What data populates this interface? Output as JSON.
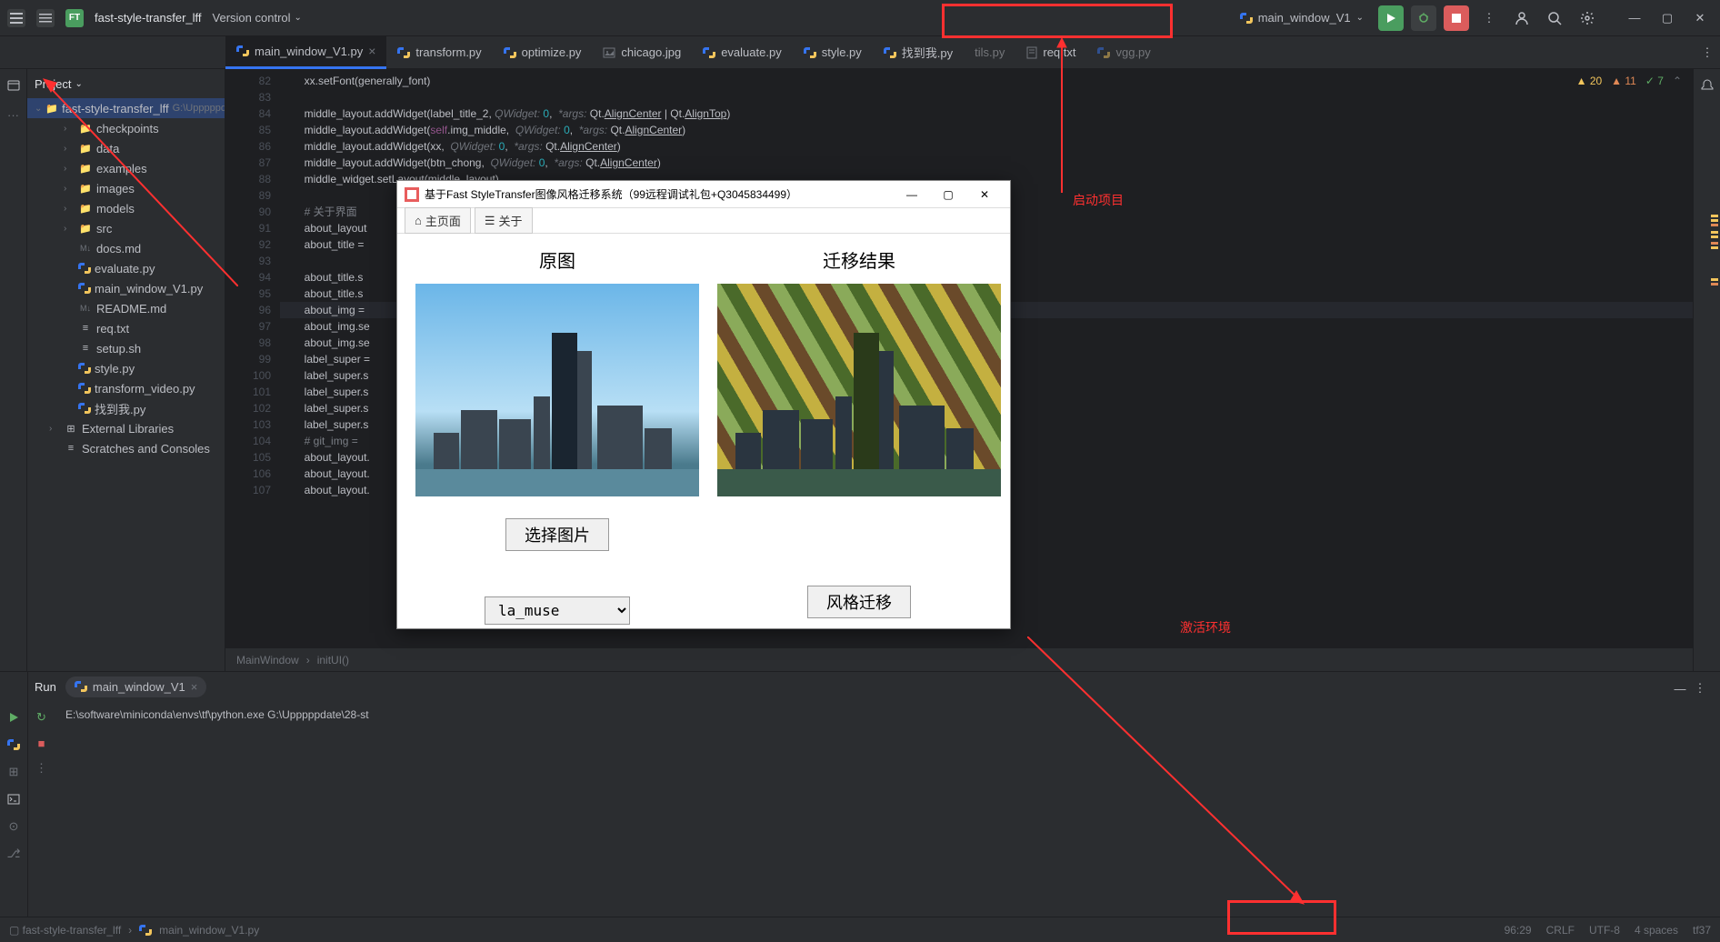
{
  "titlebar": {
    "project_badge": "FT",
    "project_name": "fast-style-transfer_lff",
    "version_control": "Version control",
    "run_config": "main_window_V1"
  },
  "tabs": [
    {
      "name": "main_window_V1.py",
      "type": "py",
      "active": true
    },
    {
      "name": "transform.py",
      "type": "py"
    },
    {
      "name": "optimize.py",
      "type": "py"
    },
    {
      "name": "chicago.jpg",
      "type": "img"
    },
    {
      "name": "evaluate.py",
      "type": "py"
    },
    {
      "name": "style.py",
      "type": "py"
    },
    {
      "name": "找到我.py",
      "type": "py"
    },
    {
      "name": "tils.py",
      "type": "py"
    },
    {
      "name": "req.txt",
      "type": "txt"
    },
    {
      "name": "vgg.py",
      "type": "py"
    }
  ],
  "project": {
    "header": "Project",
    "root": "fast-style-transfer_lff",
    "root_path": "G:\\Upppppdate\\",
    "items": [
      {
        "name": "checkpoints",
        "type": "folder",
        "indent": 2
      },
      {
        "name": "data",
        "type": "folder",
        "indent": 2
      },
      {
        "name": "examples",
        "type": "folder",
        "indent": 2
      },
      {
        "name": "images",
        "type": "folder",
        "indent": 2
      },
      {
        "name": "models",
        "type": "folder",
        "indent": 2
      },
      {
        "name": "src",
        "type": "folder",
        "indent": 2
      },
      {
        "name": "docs.md",
        "type": "md",
        "indent": 2
      },
      {
        "name": "evaluate.py",
        "type": "py",
        "indent": 2
      },
      {
        "name": "main_window_V1.py",
        "type": "py",
        "indent": 2
      },
      {
        "name": "README.md",
        "type": "md",
        "indent": 2
      },
      {
        "name": "req.txt",
        "type": "txt",
        "indent": 2
      },
      {
        "name": "setup.sh",
        "type": "sh",
        "indent": 2
      },
      {
        "name": "style.py",
        "type": "py",
        "indent": 2
      },
      {
        "name": "transform_video.py",
        "type": "py",
        "indent": 2
      },
      {
        "name": "找到我.py",
        "type": "py",
        "indent": 2
      }
    ],
    "external": "External Libraries",
    "scratches": "Scratches and Consoles"
  },
  "editor": {
    "lines": [
      {
        "n": 82,
        "text": "xx.setFont(generally_font)"
      },
      {
        "n": 83,
        "text": ""
      },
      {
        "n": 84,
        "text": "middle_layout.addWidget(label_title_2, <QWidget: 0,>  <*args: >Qt.<AlignCenter> | Qt.<AlignTop>)"
      },
      {
        "n": 85,
        "text": "middle_layout.addWidget(<self>.img_middle,  <QWidget: 0,>  <*args: >Qt.<AlignCenter>)"
      },
      {
        "n": 86,
        "text": "middle_layout.addWidget(xx,  <QWidget: 0,>  <*args: >Qt.<AlignCenter>)"
      },
      {
        "n": 87,
        "text": "middle_layout.addWidget(btn_chong,  <QWidget: 0,>  <*args: >Qt.<AlignCenter>)"
      },
      {
        "n": 88,
        "text": "middle_widget.setLayout(middle_layout)"
      },
      {
        "n": 89,
        "text": ""
      },
      {
        "n": 90,
        "text": "# 关于界面"
      },
      {
        "n": 91,
        "text": "about_layout"
      },
      {
        "n": 92,
        "text": "about_title ="
      },
      {
        "n": 93,
        "text": ""
      },
      {
        "n": 94,
        "text": "about_title.s"
      },
      {
        "n": 95,
        "text": "about_title.s"
      },
      {
        "n": 96,
        "text": "about_img = ",
        "hl": true
      },
      {
        "n": 97,
        "text": "about_img.se"
      },
      {
        "n": 98,
        "text": "about_img.se"
      },
      {
        "n": 99,
        "text": "label_super ="
      },
      {
        "n": 100,
        "text": "label_super.s"
      },
      {
        "n": 101,
        "text": "label_super.s"
      },
      {
        "n": 102,
        "text": "label_super.s"
      },
      {
        "n": 103,
        "text": "label_super.s"
      },
      {
        "n": 104,
        "text": "# git_img = "
      },
      {
        "n": 105,
        "text": "about_layout."
      },
      {
        "n": 106,
        "text": "about_layout."
      },
      {
        "n": 107,
        "text": "about_layout."
      }
    ],
    "inspections": {
      "warnings_a": "20",
      "warnings_b": "11",
      "checks": "7"
    }
  },
  "breadcrumb": [
    "MainWindow",
    "initUI()"
  ],
  "run": {
    "title": "Run",
    "tab": "main_window_V1",
    "console": "E:\\software\\miniconda\\envs\\tf\\python.exe G:\\Upppppdate\\28-st"
  },
  "statusbar": {
    "path1": "fast-style-transfer_lff",
    "path2": "main_window_V1.py",
    "cursor": "96:29",
    "line_sep": "CRLF",
    "encoding": "UTF-8",
    "indent": "4 spaces",
    "interpreter": "tf37"
  },
  "app": {
    "title": "基于Fast StyleTransfer图像风格迁移系统（99远程调试礼包+Q3045834499）",
    "tab_home": "主页面",
    "tab_about": "关于",
    "col1_title": "原图",
    "col2_title": "迁移结果",
    "btn_select": "选择图片",
    "btn_transfer": "风格迁移",
    "select_value": "la_muse"
  },
  "annotations": {
    "launch": "启动项目",
    "activate": "激活环境"
  }
}
